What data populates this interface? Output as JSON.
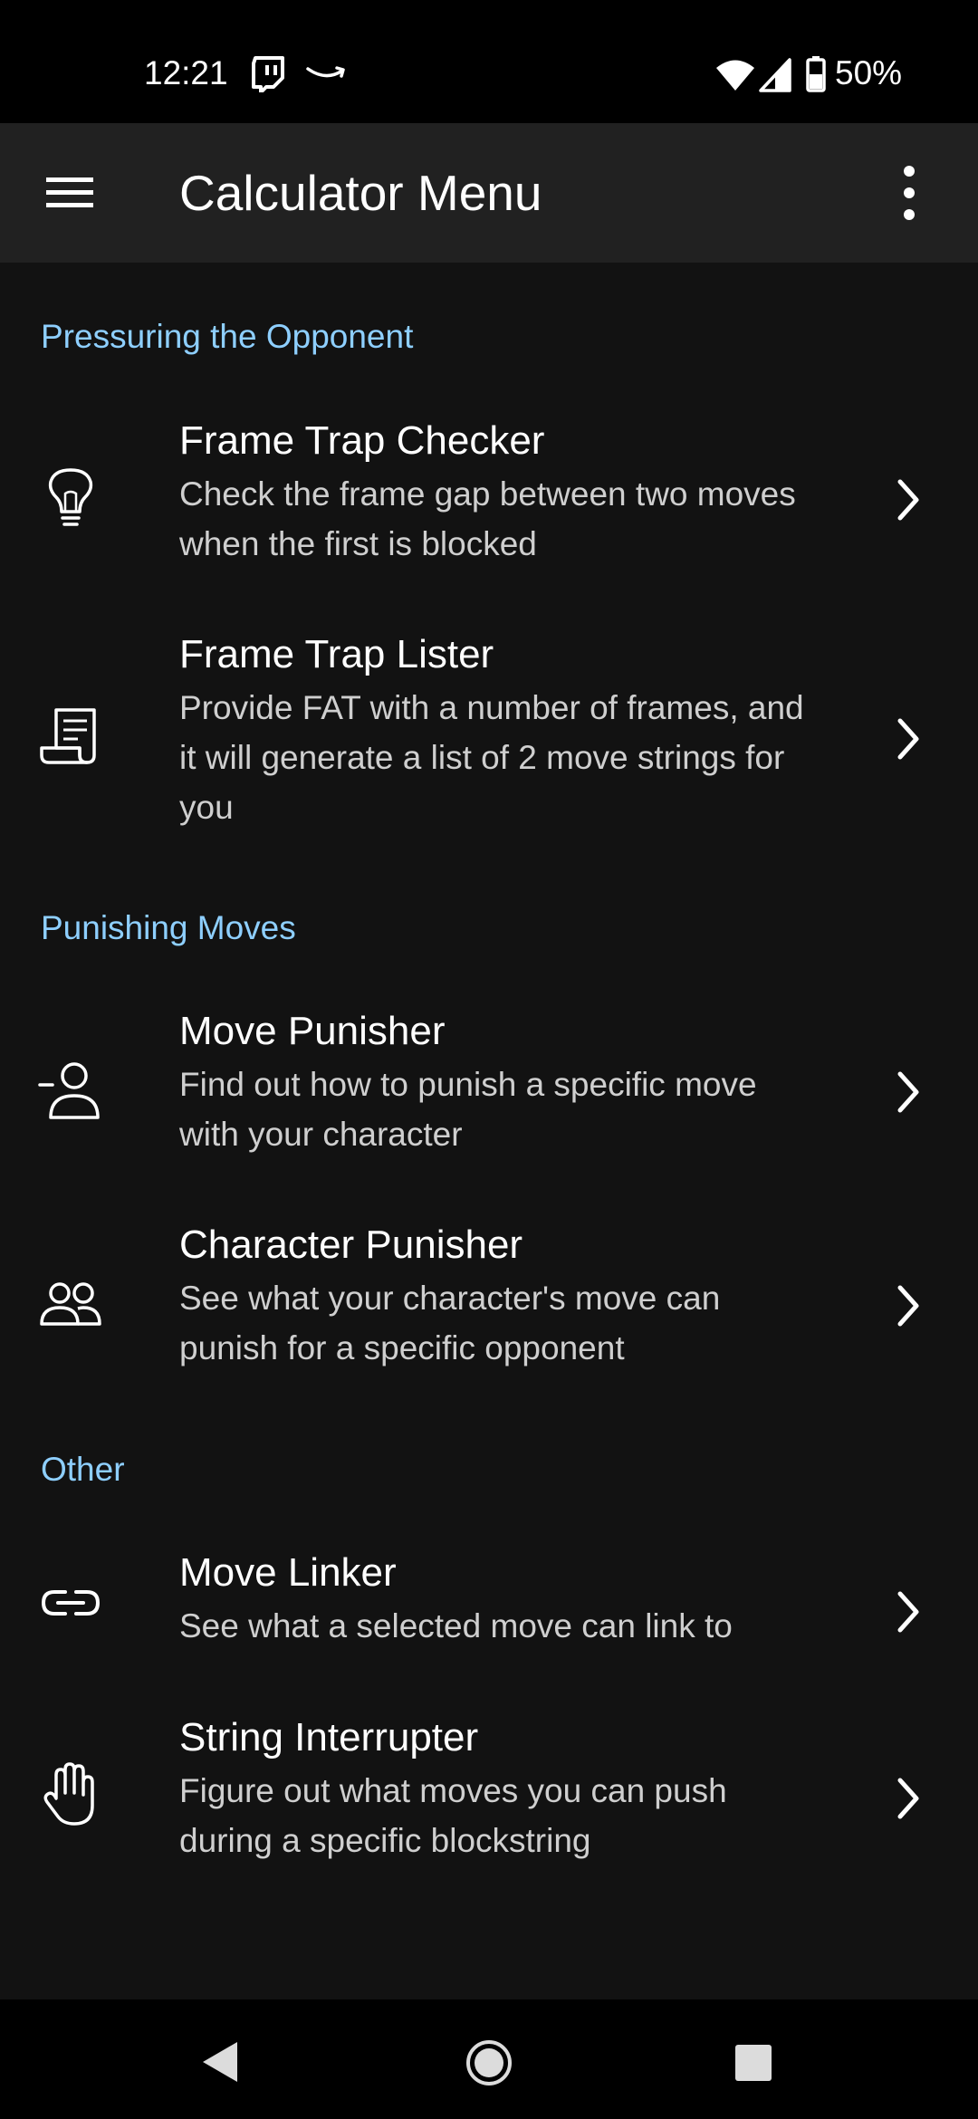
{
  "status_bar": {
    "time": "12:21",
    "battery": "50%",
    "icons": [
      "twitch-icon",
      "amazon-icon",
      "wifi-icon",
      "signal-icon",
      "battery-icon"
    ]
  },
  "app_bar": {
    "title": "Calculator Menu",
    "icons": [
      "menu-icon",
      "more-vert-icon"
    ]
  },
  "sections": [
    {
      "header": "Pressuring the Opponent",
      "items": [
        {
          "icon": "lightbulb-icon",
          "title": "Frame Trap Checker",
          "subtitle_lines": [
            "Check the frame gap between two moves",
            "when the first is blocked"
          ]
        },
        {
          "icon": "scroll-icon",
          "title": "Frame Trap Lister",
          "subtitle_lines": [
            "Provide FAT with a number of frames, and",
            "it will generate a list of 2 move strings for",
            "you"
          ]
        }
      ]
    },
    {
      "header": "Punishing Moves",
      "items": [
        {
          "icon": "user-minus-icon",
          "title": "Move Punisher",
          "subtitle_lines": [
            "Find out how to punish a specific move",
            "with your character"
          ]
        },
        {
          "icon": "users-icon",
          "title": "Character Punisher",
          "subtitle_lines": [
            "See what your character's move can",
            "punish for a specific opponent"
          ]
        }
      ]
    },
    {
      "header": "Other",
      "items": [
        {
          "icon": "link-icon",
          "title": "Move Linker",
          "subtitle_lines": [
            "See what a selected move can link to"
          ]
        },
        {
          "icon": "hand-icon",
          "title": "String Interrupter",
          "subtitle_lines": [
            "Figure out what moves you can push",
            "during a specific blockstring"
          ]
        }
      ]
    }
  ],
  "nav_bar": {
    "icons": [
      "back-icon",
      "home-icon",
      "recents-icon"
    ]
  },
  "colors": {
    "background": "#121212",
    "app_bar": "#212121",
    "section_header": "#8ecfff",
    "subtitle": "#cfcfcf"
  }
}
